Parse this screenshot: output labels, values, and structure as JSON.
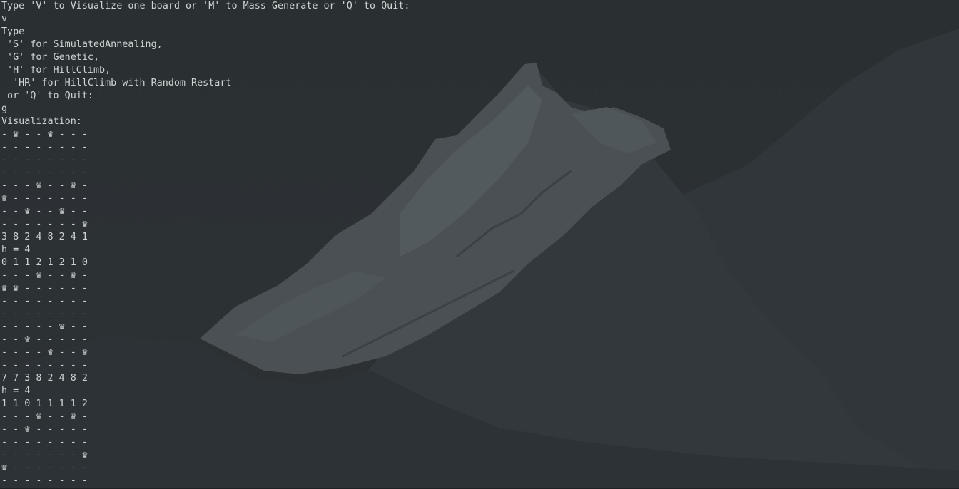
{
  "terminal": {
    "lines": [
      "Type 'V' to Visualize one board or 'M' to Mass Generate or 'Q' to Quit:",
      "v",
      "Type",
      " 'S' for SimulatedAnnealing,",
      " 'G' for Genetic,",
      " 'H' for HillClimb,",
      "  'HR' for HillClimb with Random Restart",
      " or 'Q' to Quit:",
      "g",
      "Visualization:",
      "- ♛ - - ♛ - - -",
      "- - - - - - - -",
      "- - - - - - - -",
      "- - - - - - - -",
      "- - - ♛ - - ♛ -",
      "♛ - - - - - - -",
      "- - ♛ - - ♛ - -",
      "- - - - - - - ♛",
      "3 8 2 4 8 2 4 1",
      "h = 4",
      "0 1 1 2 1 2 1 0",
      "- - - ♛ - - ♛ -",
      "♛ ♛ - - - - - -",
      "- - - - - - - -",
      "- - - - - - - -",
      "- - - - - ♛ - -",
      "- - ♛ - - - - -",
      "- - - - ♛ - - ♛",
      "- - - - - - - -",
      "7 7 3 8 2 4 8 2",
      "h = 4",
      "1 1 0 1 1 1 1 2",
      "- - - ♛ - - ♛ -",
      "- - ♛ - - - - -",
      "- - - - - - - -",
      "- - - - - - - ♛",
      "♛ - - - - - - -",
      "- - - - - - - -"
    ]
  },
  "colors": {
    "background": "#2b3033",
    "text": "#cfd3d2",
    "mountain_light": "#4a5053",
    "mountain_dark": "#33393b"
  }
}
